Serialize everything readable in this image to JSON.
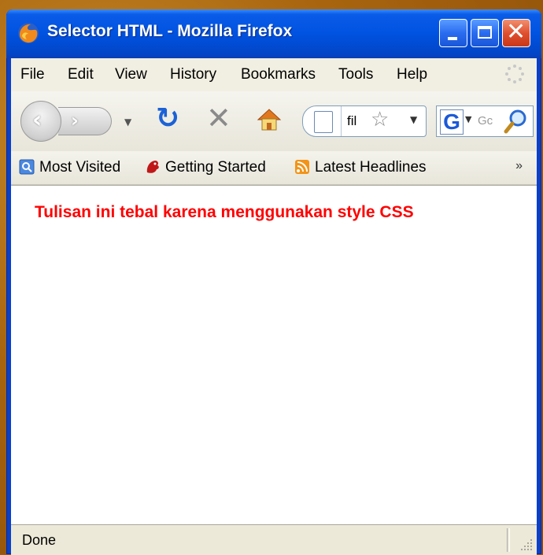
{
  "window": {
    "title": "Selector HTML - Mozilla Firefox"
  },
  "menu": [
    "File",
    "Edit",
    "View",
    "History",
    "Bookmarks",
    "Tools",
    "Help"
  ],
  "navbar": {
    "url_text": "fil",
    "search_placeholder": "Gc"
  },
  "bookmarks": [
    {
      "label": "Most Visited",
      "icon": "most-visited-icon"
    },
    {
      "label": "Getting Started",
      "icon": "getting-started-icon"
    },
    {
      "label": "Latest Headlines",
      "icon": "rss-feed-icon"
    }
  ],
  "bookmarks_overflow": "»",
  "page": {
    "text": "Tulisan ini tebal karena menggunakan style CSS",
    "text_color": "#ff0000"
  },
  "status": {
    "text": "Done"
  }
}
